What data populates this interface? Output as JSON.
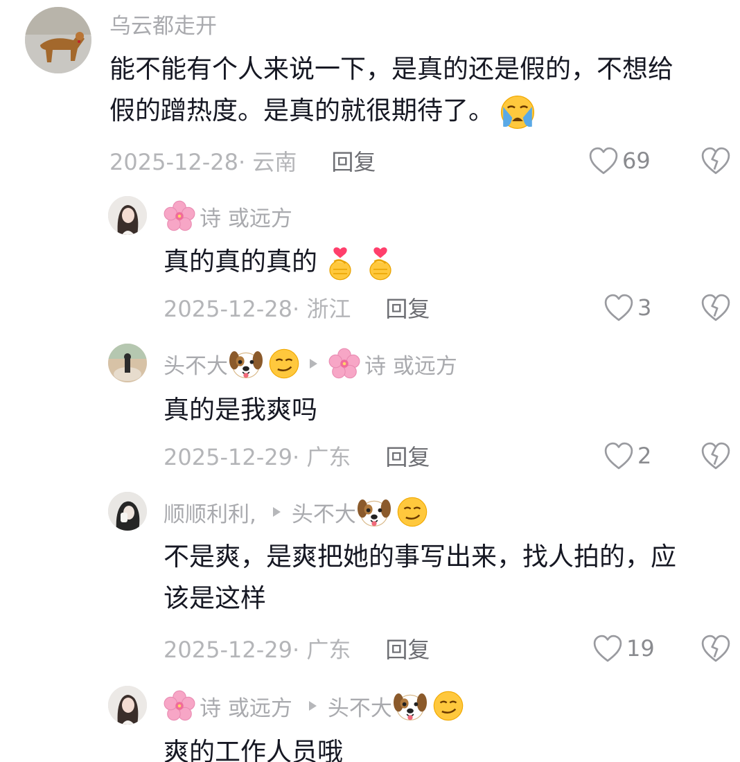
{
  "comments": [
    {
      "username": "乌云都走开",
      "text_line1": "能不能有个人来说一下，是真的还是假的，不想给",
      "text_line2": "假的蹭热度。是真的就很期待了。",
      "text_emoji": "crying-face",
      "date": "2025-12-28",
      "location": "· 云南",
      "reply_label": "回复",
      "likes": "69"
    },
    {
      "username": "诗 或远方",
      "username_prefix_emoji": "cherry-blossom",
      "text": "真的真的真的",
      "text_emojis": [
        "finger-heart",
        "finger-heart"
      ],
      "date": "2025-12-28",
      "location": "· 浙江",
      "reply_label": "回复",
      "likes": "3"
    },
    {
      "username": "头不大",
      "username_emojis": [
        "dog-face",
        "smirking-face"
      ],
      "reply_to_prefix_emoji": "cherry-blossom",
      "reply_to": "诗 或远方",
      "text": "真的是我爽吗",
      "date": "2025-12-29",
      "location": "· 广东",
      "reply_label": "回复",
      "likes": "2"
    },
    {
      "username": "顺顺利利,",
      "reply_to": "头不大",
      "reply_to_emojis": [
        "dog-face",
        "smirking-face"
      ],
      "text_line1": "不是爽，是爽把她的事写出来，找人拍的，应",
      "text_line2": "该是这样",
      "date": "2025-12-29",
      "location": "· 广东",
      "reply_label": "回复",
      "likes": "19"
    },
    {
      "username": "诗 或远方",
      "username_prefix_emoji": "cherry-blossom",
      "reply_to": "头不大",
      "reply_to_emojis": [
        "dog-face",
        "smirking-face"
      ],
      "text": "爽的工作人员哦"
    }
  ],
  "colors": {
    "username": "#a9aaae",
    "text": "#161823",
    "date": "#b4b5b8",
    "reply": "#6d6e73",
    "like": "#8a8b8f"
  },
  "icons": {
    "like": "heart-outline-icon",
    "dislike": "broken-heart-icon",
    "reply_to": "play-arrow-icon"
  }
}
